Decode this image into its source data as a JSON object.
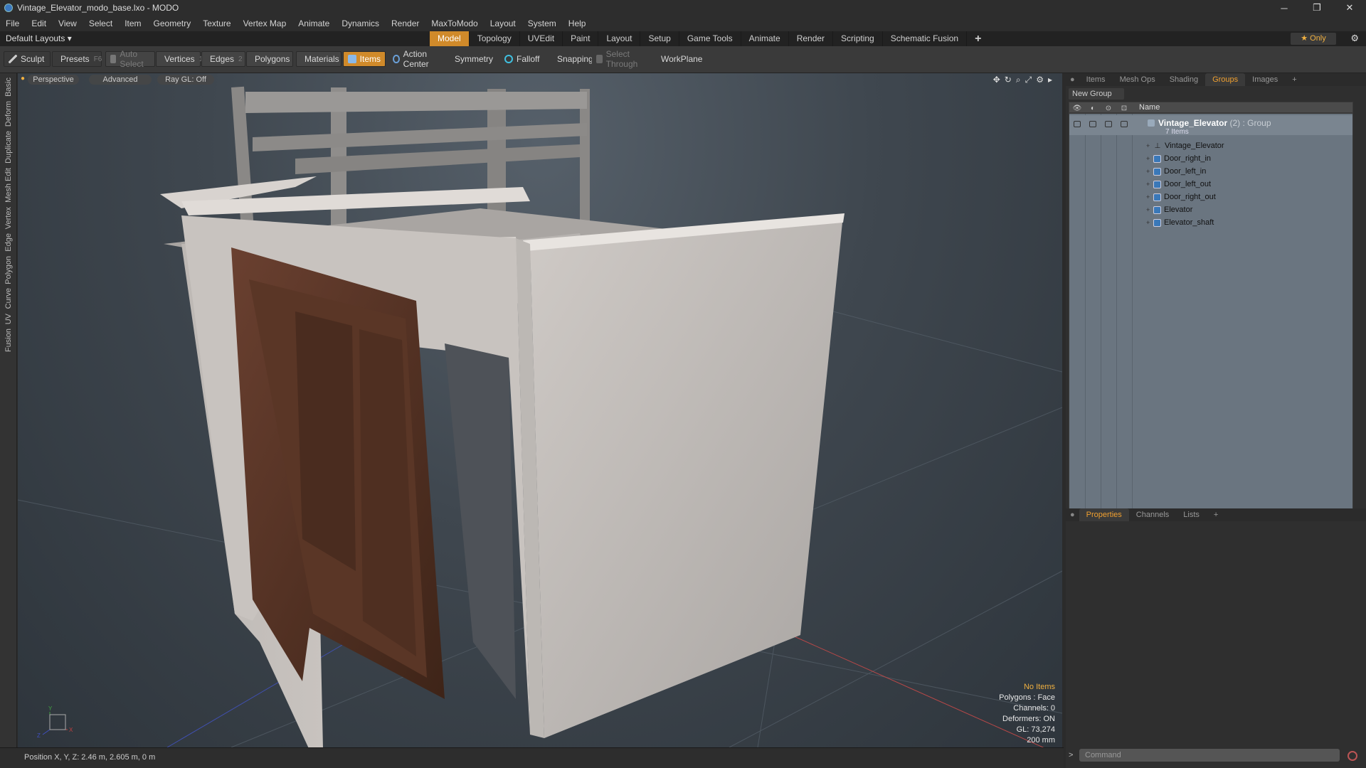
{
  "window": {
    "title": "Vintage_Elevator_modo_base.lxo - MODO",
    "controls": [
      "─",
      "❐",
      "✕"
    ]
  },
  "menu": [
    "File",
    "Edit",
    "View",
    "Select",
    "Item",
    "Geometry",
    "Texture",
    "Vertex Map",
    "Animate",
    "Dynamics",
    "Render",
    "MaxToModo",
    "Layout",
    "System",
    "Help"
  ],
  "layouts": {
    "current": "Default Layouts ▾",
    "tabs": [
      "Model",
      "Topology",
      "UVEdit",
      "Paint",
      "Layout",
      "Setup",
      "Game Tools",
      "Animate",
      "Render",
      "Scripting",
      "Schematic Fusion"
    ],
    "active_tab": "Model",
    "add": "+",
    "only_label": "★  Only",
    "gear": "⚙"
  },
  "toolbar": {
    "sculpt": "Sculpt",
    "presets": "Presets",
    "presets_key": "F6",
    "auto_select": "Auto Select",
    "vertices": "Vertices",
    "vertices_key": "1",
    "edges": "Edges",
    "edges_key": "2",
    "polygons": "Polygons",
    "materials": "Materials",
    "items": "Items",
    "action_center": "Action Center",
    "symmetry": "Symmetry",
    "falloff": "Falloff",
    "snapping": "Snapping",
    "select_through": "Select Through",
    "workplane": "WorkPlane"
  },
  "left_tabs": [
    "Basic",
    "Deform",
    "Duplicate",
    "Mesh Edit",
    "Vertex",
    "Edge",
    "Polygon",
    "Curve",
    "UV",
    "Fusion"
  ],
  "viewport": {
    "view": "Perspective",
    "shading": "Advanced",
    "raygl": "Ray GL: Off",
    "hud": {
      "selection": "No Items",
      "polygons": "Polygons : Face",
      "channels": "Channels: 0",
      "deformers": "Deformers: ON",
      "gl": "GL: 73,274",
      "grid": "200 mm"
    },
    "axis_labels": [
      "Y",
      "X",
      "Z"
    ]
  },
  "status": {
    "position": "Position X, Y, Z:   2.46 m, 2.605 m, 0 m"
  },
  "right_panel": {
    "tabs": [
      "Items",
      "Mesh Ops",
      "Shading",
      "Groups",
      "Images"
    ],
    "active_tab": "Groups",
    "new_group": "New Group",
    "name_col": "Name",
    "group": {
      "name": "Vintage_Elevator",
      "count": " (2) : Group",
      "sub": "7 Items"
    },
    "items": [
      "Vintage_Elevator",
      "Door_right_in",
      "Door_left_in",
      "Door_left_out",
      "Door_right_out",
      "Elevator",
      "Elevator_shaft"
    ],
    "bottom_tabs": [
      "Properties",
      "Channels",
      "Lists"
    ],
    "bottom_active": "Properties",
    "command_placeholder": "Command"
  }
}
